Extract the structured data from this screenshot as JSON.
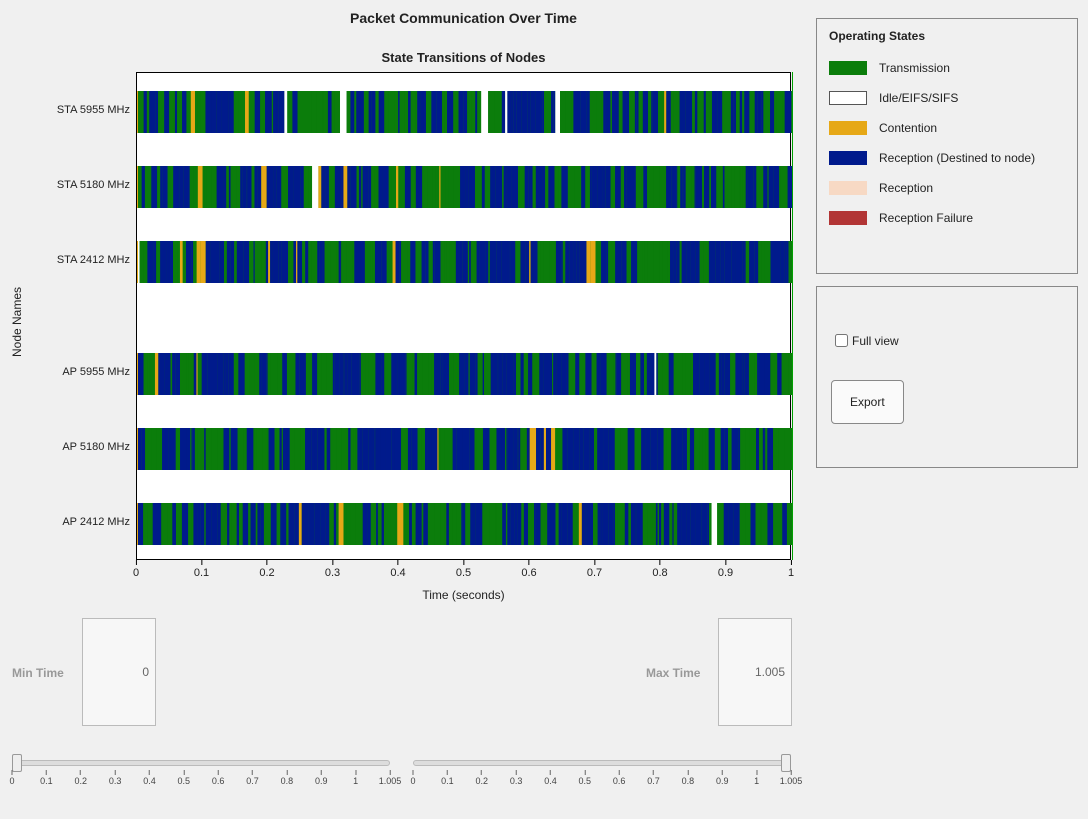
{
  "title": "Packet Communication Over Time",
  "subtitle": "State Transitions of Nodes",
  "y_axis_label": "Node Names",
  "x_axis_label": "Time (seconds)",
  "x_ticks": [
    "0",
    "0.1",
    "0.2",
    "0.3",
    "0.4",
    "0.5",
    "0.6",
    "0.7",
    "0.8",
    "0.9",
    "1"
  ],
  "nodes": [
    {
      "label": "STA 5955 MHz"
    },
    {
      "label": "STA 5180 MHz"
    },
    {
      "label": "STA 2412 MHz"
    },
    {
      "label": "AP 5955 MHz"
    },
    {
      "label": "AP 5180 MHz"
    },
    {
      "label": "AP 2412 MHz"
    }
  ],
  "legend": {
    "title": "Operating States",
    "items": [
      {
        "label": "Transmission",
        "fill": "#0b7d0b",
        "stroke": "#0b7d0b"
      },
      {
        "label": "Idle/EIFS/SIFS",
        "fill": "#ffffff",
        "stroke": "#555"
      },
      {
        "label": "Contention",
        "fill": "#e6a817",
        "stroke": "#e6a817"
      },
      {
        "label": "Reception (Destined to node)",
        "fill": "#001a8c",
        "stroke": "#001a8c"
      },
      {
        "label": "Reception",
        "fill": "#f7d9c4",
        "stroke": "#f7d9c4"
      },
      {
        "label": "Reception Failure",
        "fill": "#b23535",
        "stroke": "#b23535"
      }
    ]
  },
  "controls": {
    "full_view_label": "Full view",
    "full_view_checked": false,
    "export_label": "Export"
  },
  "min_time": {
    "label": "Min Time",
    "value": "0"
  },
  "max_time": {
    "label": "Max Time",
    "value": "1.005"
  },
  "slider_ticks": [
    "0",
    "0.1",
    "0.2",
    "0.3",
    "0.4",
    "0.5",
    "0.6",
    "0.7",
    "0.8",
    "0.9",
    "1",
    "1.005"
  ],
  "chart_data": {
    "type": "bar",
    "note": "Horizontal state-transition timeline; each node row alternates densely between Transmission and Reception (Destined to node) states across 0–1 s. Exact per-slice durations are too fine to read from pixels.",
    "xlabel": "Time (seconds)",
    "ylabel": "Node Names",
    "xlim": [
      0,
      1.005
    ],
    "categories": [
      "STA 5955 MHz",
      "STA 5180 MHz",
      "STA 2412 MHz",
      "AP 5955 MHz",
      "AP 5180 MHz",
      "AP 2412 MHz"
    ],
    "dominant_states_per_node": [
      [
        "Transmission",
        "Reception (Destined to node)",
        "Idle/EIFS/SIFS",
        "Contention"
      ],
      [
        "Transmission",
        "Reception (Destined to node)",
        "Idle/EIFS/SIFS",
        "Contention"
      ],
      [
        "Transmission",
        "Reception (Destined to node)",
        "Idle/EIFS/SIFS",
        "Contention"
      ],
      [
        "Transmission",
        "Reception (Destined to node)",
        "Idle/EIFS/SIFS",
        "Contention"
      ],
      [
        "Transmission",
        "Reception (Destined to node)",
        "Idle/EIFS/SIFS",
        "Contention"
      ],
      [
        "Transmission",
        "Reception (Destined to node)",
        "Idle/EIFS/SIFS",
        "Contention"
      ]
    ],
    "state_colors": {
      "Transmission": "#0b7d0b",
      "Idle/EIFS/SIFS": "#ffffff",
      "Contention": "#e6a817",
      "Reception (Destined to node)": "#001a8c",
      "Reception": "#f7d9c4",
      "Reception Failure": "#b23535"
    }
  }
}
